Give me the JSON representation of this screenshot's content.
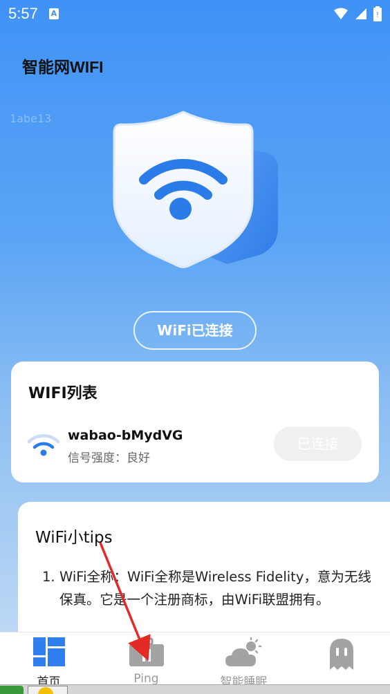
{
  "status_bar": {
    "time": "5:57",
    "app_icon_letter": "A"
  },
  "header": {
    "title": "智能网WIFI",
    "watermark": "1abe13"
  },
  "hero": {
    "icon": "shield-wifi-icon",
    "connected_label": "WiFi已连接"
  },
  "wifi_list": {
    "title": "WIFI列表",
    "networks": [
      {
        "ssid": "wabao-bMydVG",
        "signal": "信号强度：良好",
        "button": "已连接"
      }
    ]
  },
  "tips": {
    "title": "WiFi小tips",
    "items": [
      {
        "num": "1.",
        "text": "WiFi全称：WiFi全称是Wireless Fidelity，意为无线保真。它是一个注册商标，由WiFi联盟拥有。"
      }
    ]
  },
  "nav": {
    "items": [
      {
        "label": "首页",
        "icon": "home-grid-icon"
      },
      {
        "label": "Ping",
        "icon": "toolbox-icon"
      },
      {
        "label": "智能睡眠",
        "icon": "weather-cloud-icon"
      },
      {
        "label": "",
        "icon": "ghost-icon"
      }
    ]
  },
  "colors": {
    "accent": "#3f92f6",
    "icon_blue": "#2b7be8",
    "nav_active": "#2f7ff0"
  }
}
